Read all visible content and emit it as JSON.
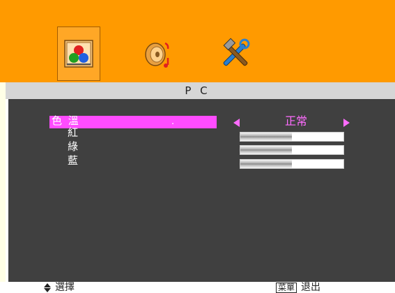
{
  "tabs": [
    {
      "name": "picture",
      "icon": "color-circles-icon",
      "selected": true
    },
    {
      "name": "audio",
      "icon": "speaker-icon",
      "selected": false
    },
    {
      "name": "setup",
      "icon": "hammer-wrench-icon",
      "selected": false
    }
  ],
  "title": "P C",
  "menu": {
    "color_temperature": {
      "label": "色 溫",
      "marker": ".",
      "value": "正常"
    },
    "rgb": [
      {
        "label": "紅",
        "level": 0.5
      },
      {
        "label": "綠",
        "level": 0.5
      },
      {
        "label": "藍",
        "level": 0.5
      }
    ]
  },
  "footer": {
    "select_label": "選擇",
    "menu_key": "菜單",
    "exit_label": "退出"
  },
  "colors": {
    "top_bar": "#ff9a00",
    "panel": "#404040",
    "highlight": "#ff4cff",
    "value_accent": "#ff6cff"
  }
}
